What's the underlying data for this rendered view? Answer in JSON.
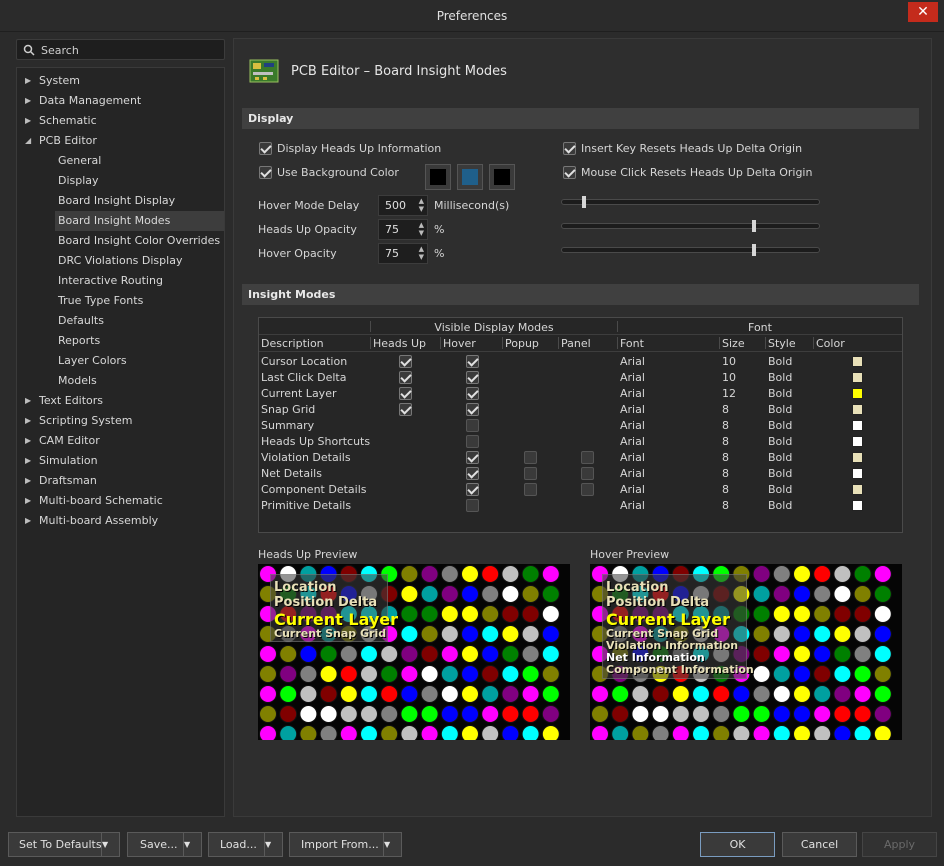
{
  "window": {
    "title": "Preferences",
    "close_icon": "close-icon"
  },
  "search": {
    "placeholder": "Search"
  },
  "tree": [
    {
      "label": "System",
      "level": 0,
      "arrow": "right"
    },
    {
      "label": "Data Management",
      "level": 0,
      "arrow": "right"
    },
    {
      "label": "Schematic",
      "level": 0,
      "arrow": "right"
    },
    {
      "label": "PCB Editor",
      "level": 0,
      "arrow": "down"
    },
    {
      "label": "General",
      "level": 1
    },
    {
      "label": "Display",
      "level": 1
    },
    {
      "label": "Board Insight Display",
      "level": 1
    },
    {
      "label": "Board Insight Modes",
      "level": 1,
      "selected": true
    },
    {
      "label": "Board Insight Color Overrides",
      "level": 1
    },
    {
      "label": "DRC Violations Display",
      "level": 1
    },
    {
      "label": "Interactive Routing",
      "level": 1
    },
    {
      "label": "True Type Fonts",
      "level": 1
    },
    {
      "label": "Defaults",
      "level": 1
    },
    {
      "label": "Reports",
      "level": 1
    },
    {
      "label": "Layer Colors",
      "level": 1
    },
    {
      "label": "Models",
      "level": 1
    },
    {
      "label": "Text Editors",
      "level": 0,
      "arrow": "right"
    },
    {
      "label": "Scripting System",
      "level": 0,
      "arrow": "right"
    },
    {
      "label": "CAM Editor",
      "level": 0,
      "arrow": "right"
    },
    {
      "label": "Simulation",
      "level": 0,
      "arrow": "right"
    },
    {
      "label": "Draftsman",
      "level": 0,
      "arrow": "right"
    },
    {
      "label": "Multi-board Schematic",
      "level": 0,
      "arrow": "right"
    },
    {
      "label": "Multi-board Assembly",
      "level": 0,
      "arrow": "right"
    }
  ],
  "page": {
    "title": "PCB Editor – Board Insight Modes",
    "icon": "pcb-board-icon"
  },
  "display": {
    "section": "Display",
    "heads_up_info": {
      "label": "Display Heads Up Information",
      "checked": true
    },
    "use_bg_color": {
      "label": "Use Background Color",
      "checked": true
    },
    "insert_key_resets": {
      "label": "Insert Key Resets Heads Up Delta Origin",
      "checked": true
    },
    "mouse_click_resets": {
      "label": "Mouse Click Resets Heads Up Delta Origin",
      "checked": true
    },
    "swatches": [
      "#000000",
      "#1f5f8a",
      "#000000"
    ],
    "hover_delay": {
      "label": "Hover Mode Delay",
      "value": "500",
      "unit": "Millisecond(s)",
      "slider_fraction": 0.08
    },
    "heads_up_opacity": {
      "label": "Heads Up Opacity",
      "value": "75",
      "unit": "%",
      "slider_fraction": 0.75
    },
    "hover_opacity": {
      "label": "Hover Opacity",
      "value": "75",
      "unit": "%",
      "slider_fraction": 0.75
    }
  },
  "insight": {
    "section": "Insight Modes",
    "group_headers": {
      "visible": "Visible Display Modes",
      "font": "Font"
    },
    "columns": [
      "Description",
      "Heads Up",
      "Hover",
      "Popup",
      "Panel",
      "Font",
      "Size",
      "Style",
      "Color"
    ],
    "rows": [
      {
        "desc": "Cursor Location",
        "heads_up": true,
        "hover": true,
        "popup": null,
        "panel": null,
        "font": "Arial",
        "size": "10",
        "style": "Bold",
        "color": "#e8e0b8"
      },
      {
        "desc": "Last Click Delta",
        "heads_up": true,
        "hover": true,
        "popup": null,
        "panel": null,
        "font": "Arial",
        "size": "10",
        "style": "Bold",
        "color": "#e8e0b8"
      },
      {
        "desc": "Current Layer",
        "heads_up": true,
        "hover": true,
        "popup": null,
        "panel": null,
        "font": "Arial",
        "size": "12",
        "style": "Bold",
        "color": "#ffff00"
      },
      {
        "desc": "Snap Grid",
        "heads_up": true,
        "hover": true,
        "popup": null,
        "panel": null,
        "font": "Arial",
        "size": "8",
        "style": "Bold",
        "color": "#e8e0b8"
      },
      {
        "desc": "Summary",
        "heads_up": null,
        "hover": false,
        "popup": null,
        "panel": null,
        "font": "Arial",
        "size": "8",
        "style": "Bold",
        "color": "#ffffff"
      },
      {
        "desc": "Heads Up Shortcuts",
        "heads_up": null,
        "hover": false,
        "popup": null,
        "panel": null,
        "font": "Arial",
        "size": "8",
        "style": "Bold",
        "color": "#ffffff"
      },
      {
        "desc": "Violation Details",
        "heads_up": null,
        "hover": true,
        "popup": false,
        "panel": false,
        "font": "Arial",
        "size": "8",
        "style": "Bold",
        "color": "#e8e0b8"
      },
      {
        "desc": "Net Details",
        "heads_up": null,
        "hover": true,
        "popup": false,
        "panel": false,
        "font": "Arial",
        "size": "8",
        "style": "Bold",
        "color": "#ffffff"
      },
      {
        "desc": "Component Details",
        "heads_up": null,
        "hover": true,
        "popup": false,
        "panel": false,
        "font": "Arial",
        "size": "8",
        "style": "Bold",
        "color": "#e8e0b8"
      },
      {
        "desc": "Primitive Details",
        "heads_up": null,
        "hover": false,
        "popup": null,
        "panel": null,
        "font": "Arial",
        "size": "8",
        "style": "Bold",
        "color": "#ffffff"
      }
    ]
  },
  "previews": {
    "heads_up": {
      "label": "Heads Up Preview",
      "lines": [
        {
          "text": "Location",
          "size": "s",
          "color": "#e8e0b8"
        },
        {
          "text": "Position Delta",
          "size": "s",
          "color": "#e8e0b8"
        },
        {
          "text": "Current Layer",
          "size": "l",
          "color": "#ffff00"
        },
        {
          "text": "Current Snap Grid",
          "size": "xs",
          "color": "#e8e0b8"
        }
      ]
    },
    "hover": {
      "label": "Hover Preview",
      "lines": [
        {
          "text": "Location",
          "size": "s",
          "color": "#e8e0b8"
        },
        {
          "text": "Position Delta",
          "size": "s",
          "color": "#e8e0b8"
        },
        {
          "text": "Current Layer",
          "size": "l",
          "color": "#ffff00"
        },
        {
          "text": "Current Snap Grid",
          "size": "xs",
          "color": "#e8e0b8"
        },
        {
          "text": "Violation Information",
          "size": "xs",
          "color": "#e8e0b8"
        },
        {
          "text": "Net Information",
          "size": "xs",
          "color": "#ffffff"
        },
        {
          "text": "Component Information",
          "size": "xs",
          "color": "#e8e0b8"
        }
      ]
    }
  },
  "footer": {
    "set_defaults": "Set To Defaults",
    "save": "Save...",
    "load": "Load...",
    "import": "Import From...",
    "ok": "OK",
    "cancel": "Cancel",
    "apply": "Apply"
  }
}
